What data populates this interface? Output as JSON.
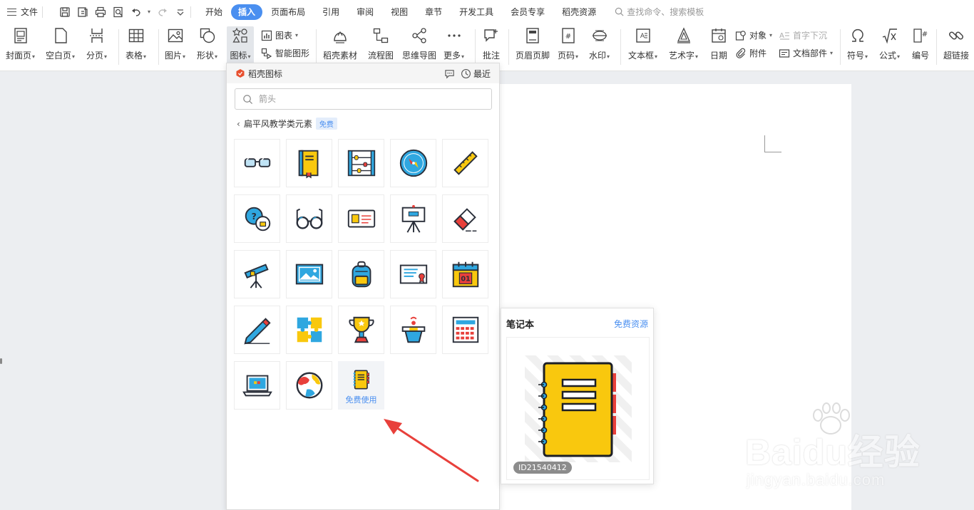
{
  "menubar": {
    "file_label": "文件",
    "tabs": [
      "开始",
      "插入",
      "页面布局",
      "引用",
      "审阅",
      "视图",
      "章节",
      "开发工具",
      "会员专享",
      "稻壳资源"
    ],
    "active_tab": "插入",
    "search_placeholder": "查找命令、搜索模板"
  },
  "ribbon": {
    "cover": "封面页",
    "blank": "空白页",
    "pagebreak": "分页",
    "table": "表格",
    "picture": "图片",
    "shape": "形状",
    "icon": "图标",
    "chart": "图表",
    "smartgraphic": "智能图形",
    "material": "稻壳素材",
    "flowchart": "流程图",
    "mindmap": "思维导图",
    "more": "更多",
    "comment": "批注",
    "headerfooter": "页眉页脚",
    "pagenum": "页码",
    "watermark": "水印",
    "textbox": "文本框",
    "wordart": "艺术字",
    "date": "日期",
    "object": "对象",
    "dropcap": "首字下沉",
    "attachment": "附件",
    "docpart": "文档部件",
    "symbol": "符号",
    "formula": "公式",
    "numbering": "编号",
    "hyperlink": "超链接"
  },
  "panel": {
    "title": "稻壳图标",
    "recent": "最近",
    "search_value": "箭头",
    "category": "扁平风教学类元素",
    "category_badge": "免费",
    "hover_label": "免费使用",
    "icons": [
      "glasses",
      "book",
      "abacus",
      "compass",
      "ruler",
      "chat-lock",
      "round-glasses",
      "id-card",
      "easel",
      "eraser",
      "telescope",
      "picture",
      "backpack",
      "certificate",
      "calendar",
      "pencil",
      "puzzle",
      "trophy",
      "podium",
      "calculator",
      "laptop",
      "globe",
      "notebook"
    ]
  },
  "preview": {
    "title": "笔记本",
    "link": "免费资源",
    "id": "ID21540412"
  },
  "watermark": {
    "main": "Baidu经验",
    "sub": "jingyan.baidu.com"
  },
  "colors": {
    "accent": "#4a8ff0",
    "arrow": "#e8403b",
    "notebook": "#f9c80e"
  }
}
